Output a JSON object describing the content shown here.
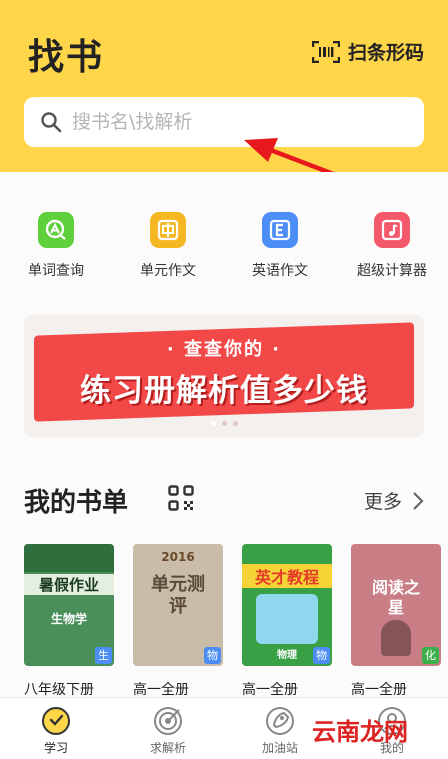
{
  "header": {
    "title": "找书",
    "scan_label": "扫条形码",
    "search_placeholder": "搜书名\\找解析"
  },
  "tools": [
    {
      "label": "单词查询",
      "icon": "word-search-icon",
      "color": "#5fcf3c"
    },
    {
      "label": "单元作文",
      "icon": "unit-essay-icon",
      "color": "#f5b823"
    },
    {
      "label": "英语作文",
      "icon": "english-essay-icon",
      "color": "#4c8ef5"
    },
    {
      "label": "超级计算器",
      "icon": "super-calculator-icon",
      "color": "#f2596b"
    }
  ],
  "banner": {
    "subtitle": "· 查查你的 ·",
    "title": "练习册解析值多少钱",
    "page_count": 3,
    "active_page": 1
  },
  "booklist": {
    "title": "我的书单",
    "more_label": "更多",
    "books": [
      {
        "name": "八年级下册",
        "subject": "生",
        "subject_color": "#4c8ef5",
        "cover_text": "暑假作业",
        "cover_sub": "生物学",
        "cover_bg": "#4a8f5a"
      },
      {
        "name": "高一全册",
        "subject": "物",
        "subject_color": "#4c8ef5",
        "cover_text": "单元测评",
        "cover_sub": "2016",
        "cover_bg": "#c9bca8"
      },
      {
        "name": "高一全册",
        "subject": "物",
        "subject_color": "#4c8ef5",
        "cover_text": "英才教程",
        "cover_sub": "物理",
        "cover_bg": "#3aa046"
      },
      {
        "name": "高一全册",
        "subject": "化",
        "subject_color": "#3bb04a",
        "cover_text": "阅读之星",
        "cover_sub": "",
        "cover_bg": "#c97e86"
      }
    ]
  },
  "tabbar": {
    "tabs": [
      {
        "label": "学习",
        "icon": "study-icon",
        "active": true
      },
      {
        "label": "求解析",
        "icon": "target-icon",
        "active": false
      },
      {
        "label": "加油站",
        "icon": "rocket-icon",
        "active": false
      },
      {
        "label": "我的",
        "icon": "profile-icon",
        "active": false
      }
    ]
  },
  "watermark": "云南龙网",
  "colors": {
    "brand_yellow": "#ffd64a",
    "arrow_red": "#e8191c",
    "banner_red": "#f24848"
  }
}
